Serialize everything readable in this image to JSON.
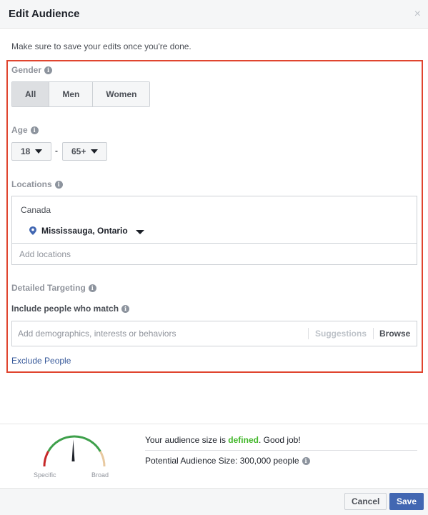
{
  "dialog": {
    "title": "Edit Audience",
    "close_glyph": "×"
  },
  "note": "Make sure to save your edits once you're done.",
  "gender": {
    "label": "Gender",
    "options": [
      "All",
      "Men",
      "Women"
    ],
    "selected": "All"
  },
  "age": {
    "label": "Age",
    "min": "18",
    "separator": "-",
    "max": "65+"
  },
  "locations": {
    "label": "Locations",
    "country": "Canada",
    "selected_location": "Mississauga, Ontario",
    "placeholder": "Add locations"
  },
  "detailed_targeting": {
    "label": "Detailed Targeting",
    "include_label": "Include people who match",
    "placeholder": "Add demographics, interests or behaviors",
    "suggestions_label": "Suggestions",
    "browse_label": "Browse"
  },
  "exclude_link": "Exclude People",
  "audience": {
    "gauge_left_label": "Specific",
    "gauge_right_label": "Broad",
    "size_prefix": "Your audience size is ",
    "size_status": "defined",
    "size_suffix": ". Good job!",
    "potential_text": "Potential Audience Size: 300,000 people",
    "gauge_level": 0.5
  },
  "footer": {
    "cancel_label": "Cancel",
    "save_label": "Save"
  },
  "colors": {
    "highlight_frame": "#e0452f",
    "primary": "#4267b2",
    "link": "#365899",
    "success": "#42b72a",
    "gauge_red": "#c62828",
    "gauge_green": "#3ea04b",
    "gauge_tan": "#e8c9a0"
  },
  "icons": {
    "info": "info-circle-icon",
    "location": "location-pin-icon",
    "close": "close-icon",
    "dropdown": "caret-down-icon"
  }
}
